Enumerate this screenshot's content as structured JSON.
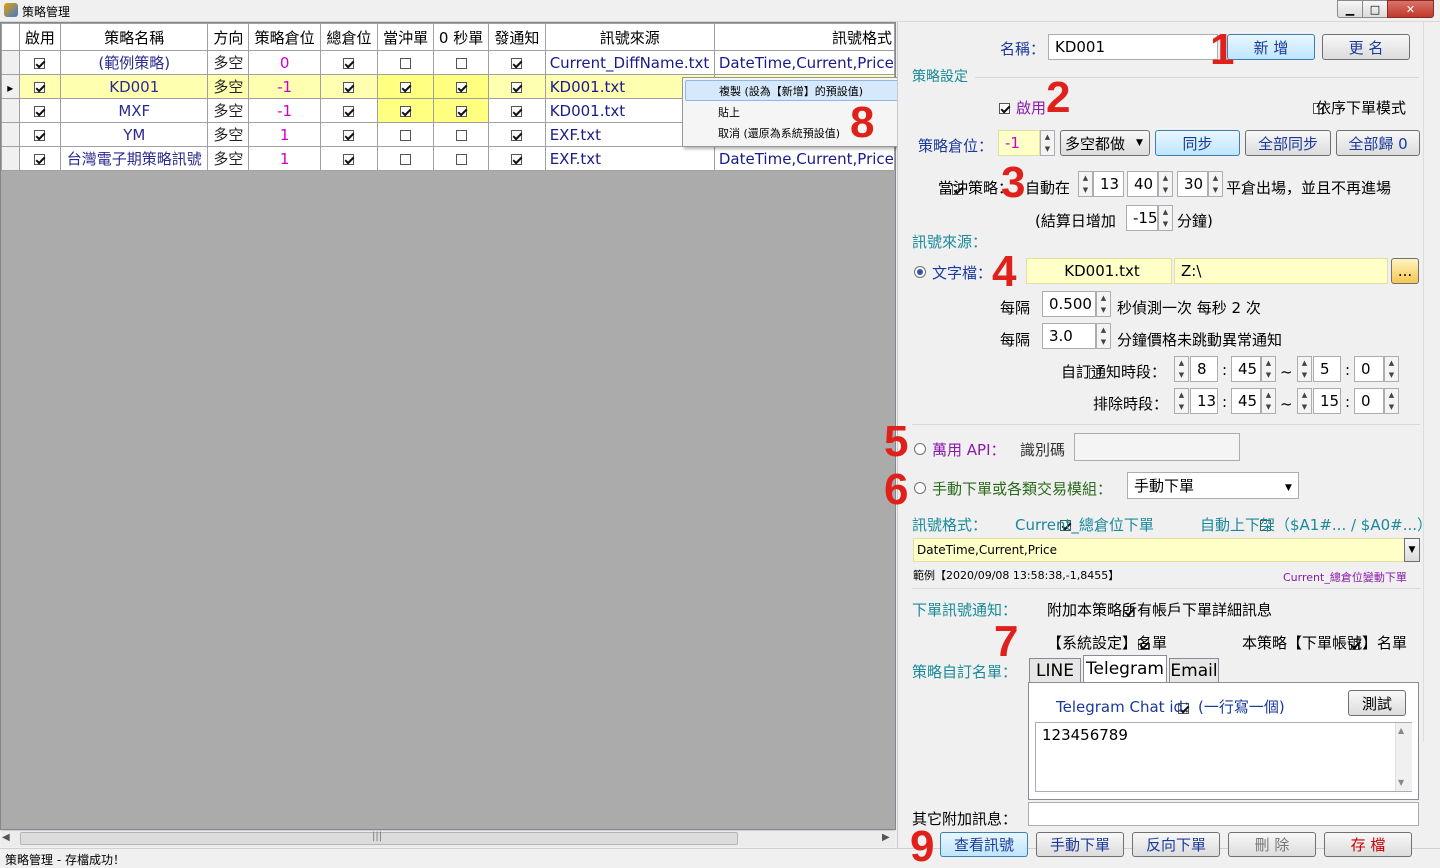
{
  "window": {
    "title": "策略管理",
    "min": "▁",
    "max": "□",
    "close": "✕"
  },
  "grid": {
    "columns": [
      "啟用",
      "策略名稱",
      "方向",
      "策略倉位",
      "總倉位",
      "當沖單",
      "0 秒單",
      "發通知",
      "訊號來源",
      "訊號格式"
    ],
    "rows": [
      {
        "enabled": true,
        "name": "(範例策略)",
        "dir": "多空",
        "pos": "0",
        "total": true,
        "day": false,
        "zero": false,
        "notify": true,
        "src": "Current_DiffName.txt",
        "fmt": "DateTime,Current,Price"
      },
      {
        "enabled": true,
        "name": "KD001",
        "dir": "多空",
        "pos": "-1",
        "total": true,
        "day": true,
        "zero": true,
        "notify": true,
        "src": "KD001.txt",
        "fmt": ""
      },
      {
        "enabled": true,
        "name": "MXF",
        "dir": "多空",
        "pos": "-1",
        "total": true,
        "day": true,
        "zero": true,
        "notify": true,
        "src": "KD001.txt",
        "fmt": ""
      },
      {
        "enabled": true,
        "name": "YM",
        "dir": "多空",
        "pos": "1",
        "total": true,
        "day": false,
        "zero": false,
        "notify": true,
        "src": "EXF.txt",
        "fmt": ""
      },
      {
        "enabled": true,
        "name": "台灣電子期策略訊號",
        "dir": "多空",
        "pos": "1",
        "total": true,
        "day": false,
        "zero": false,
        "notify": true,
        "src": "EXF.txt",
        "fmt": "DateTime,Current,Price"
      }
    ]
  },
  "context_menu": {
    "items": [
      "複製 (設為【新增】的預設值)",
      "貼上",
      "取消 (還原為系統預設值)"
    ]
  },
  "status": "策略管理 - 存檔成功！",
  "panel": {
    "name_label": "名稱：",
    "name_value": "KD001",
    "btn_add": "新 增",
    "btn_rename": "更 名",
    "strategy_settings": "策略設定",
    "enable_label": "啟用",
    "order_mode_label": "依序下單模式",
    "pos_label": "策略倉位：",
    "pos_value": "-1",
    "pos_mode": "多空都做",
    "btn_sync": "同步",
    "btn_sync_all": "全部同步",
    "btn_reset_all": "全部歸 0",
    "daytrade_label": "當沖策略：",
    "auto_at": "自動在",
    "time_h": "13",
    "time_m": "40",
    "time_s": "30",
    "exit_text": "平倉出場，並且不再進場",
    "settle_pre": "(結算日增加",
    "settle_value": "-15",
    "settle_post": "分鐘)",
    "signal_source": "訊號來源：",
    "textfile_label": "文字檔：",
    "textfile_name": "KD001.txt",
    "textfile_path": "Z:\\",
    "browse": "...",
    "every1": "每隔",
    "interval_value": "0.500",
    "interval_text": "秒偵測一次 每秒 2 次",
    "every2": "每隔",
    "alert_value": "3.0",
    "alert_text": "分鐘價格未跳動異常通知",
    "custom_notify": "自訂通知時段：",
    "n_h1": "8",
    "n_m1": "45",
    "n_h2": "5",
    "n_m2": "0",
    "exclude": "排除時段：",
    "e_h1": "13",
    "e_m1": "45",
    "e_h2": "15",
    "e_m2": "0",
    "tilde": "~",
    "colon": ":",
    "api_label": "萬用 API：",
    "api_id_label": "識別碼",
    "manual_label": "手動下單或各類交易模組：",
    "manual_value": "手動下單",
    "fmt_label": "訊號格式：",
    "fmt_check1": "Current_總倉位下單",
    "fmt_check2": "自動上下架（$A1#... / $A0#...）",
    "fmt_value": "DateTime,Current,Price",
    "example": "範例【2020/09/08 13:58:38,-1,8455】",
    "example_right": "Current_總倉位變動下單",
    "order_notify": "下單訊號通知：",
    "attach_detail": "附加本策略所有帳戶下單詳細訊息",
    "sys_list": "【系統設定】名單",
    "acct_list": "本策略【下單帳號】名單",
    "custom_list": "策略自訂名單：",
    "tabs": [
      "LINE",
      "Telegram",
      "Email"
    ],
    "chat_id_label": "Telegram Chat id：(一行寫一個)",
    "btn_test": "測試",
    "chat_id_value": "123456789",
    "extra_msg": "其它附加訊息：",
    "btn_view": "查看訊號",
    "btn_manual": "手動下單",
    "btn_reverse": "反向下單",
    "btn_delete": "刪 除",
    "btn_save": "存 檔"
  },
  "annotations": [
    "1",
    "2",
    "3",
    "4",
    "5",
    "6",
    "7",
    "8",
    "9"
  ],
  "colors": {
    "accent_red": "#e0201a",
    "highlight_yellow": "#ffffb0",
    "teal": "#1a8a9a"
  }
}
